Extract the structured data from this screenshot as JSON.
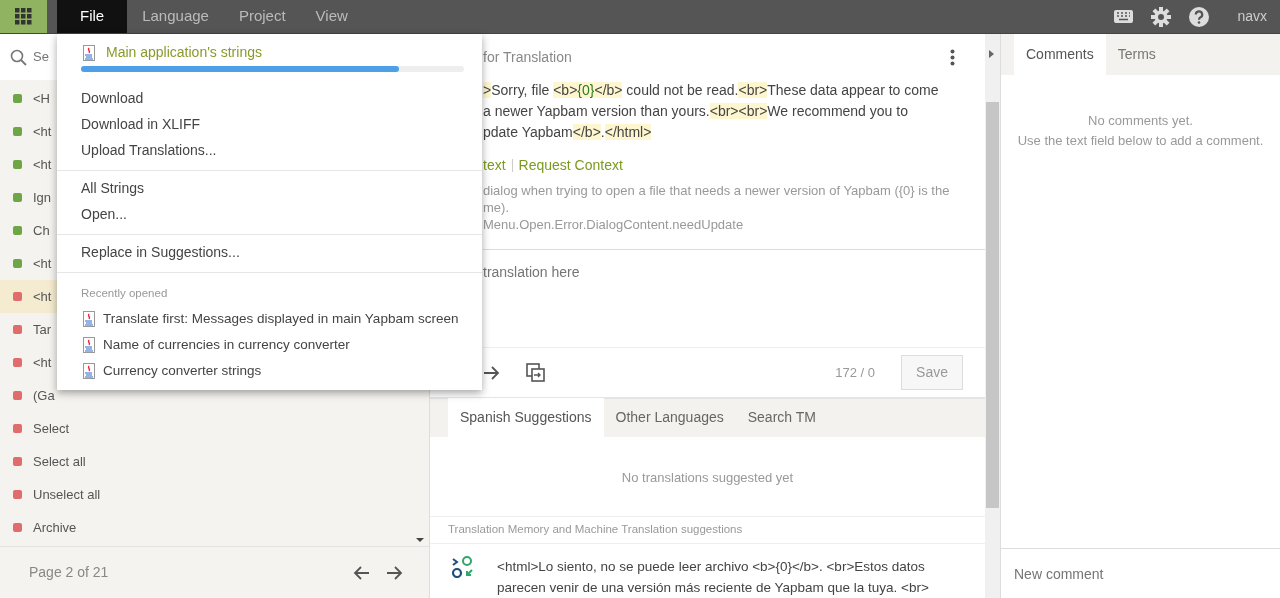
{
  "top_bar": {
    "menus": [
      {
        "label": "File",
        "selected": true
      },
      {
        "label": "Language",
        "selected": false
      },
      {
        "label": "Project",
        "selected": false
      },
      {
        "label": "View",
        "selected": false
      }
    ],
    "user": "navx"
  },
  "file_menu": {
    "file": {
      "name": "Main application's strings",
      "level": 0.83
    },
    "groups": [
      [
        "Download",
        "Download in XLIFF",
        "Upload Translations..."
      ],
      [
        "All Strings",
        "Open..."
      ],
      [
        "Replace in Suggestions..."
      ]
    ],
    "recent_label": "Recently opened",
    "recent": [
      "Translate first: Messages displayed in main Yapbam screen",
      "Name of currencies in currency converter",
      "Currency converter strings"
    ]
  },
  "strings_panel": {
    "search": {
      "placeholder": "Se"
    },
    "items": [
      {
        "text": "<H",
        "color": "#6ea646",
        "selected": false
      },
      {
        "text": "<ht",
        "color": "#6ea646",
        "selected": false
      },
      {
        "text": "<ht",
        "color": "#6ea646",
        "selected": false
      },
      {
        "text": "Ign",
        "color": "#6ea646",
        "selected": false
      },
      {
        "text": "Ch",
        "color": "#6ea646",
        "selected": false
      },
      {
        "text": "<ht",
        "color": "#6ea646",
        "selected": false
      },
      {
        "text": "<ht",
        "color": "#e06c6c",
        "selected": true
      },
      {
        "text": "Tar",
        "color": "#e06c6c",
        "selected": false
      },
      {
        "text": "<ht",
        "color": "#e06c6c",
        "selected": false
      },
      {
        "text": "(Ga",
        "color": "#e06c6c",
        "selected": false
      },
      {
        "text": "Select",
        "color": "#e06c6c",
        "selected": false
      },
      {
        "text": "Select all",
        "color": "#e06c6c",
        "selected": false
      },
      {
        "text": "Unselect all",
        "color": "#e06c6c",
        "selected": false
      },
      {
        "text": "Archive",
        "color": "#e06c6c",
        "selected": false
      }
    ],
    "page": "Page 2 of 21"
  },
  "editor": {
    "title": "for Translation",
    "source_lines": [
      [
        {
          "kind": "tag",
          "text": ">"
        },
        {
          "kind": "text",
          "text": "Sorry, file "
        },
        {
          "kind": "tag",
          "text": "<b>"
        },
        {
          "kind": "var",
          "text": "{0}"
        },
        {
          "kind": "tag",
          "text": "</b>"
        },
        {
          "kind": "text",
          "text": " could not be read."
        },
        {
          "kind": "tag",
          "text": "<br>"
        },
        {
          "kind": "text",
          "text": "These data appear to come"
        }
      ],
      [
        {
          "kind": "text",
          "text": "a newer Yapbam version than yours."
        },
        {
          "kind": "tag",
          "text": "<br><br>"
        },
        {
          "kind": "text",
          "text": "We recommend you to"
        }
      ],
      [
        {
          "kind": "text",
          "text": "pdate Yapbam"
        },
        {
          "kind": "tag",
          "text": "</b>"
        },
        {
          "kind": "text",
          "text": "."
        },
        {
          "kind": "tag",
          "text": "</html>"
        }
      ]
    ],
    "links": [
      "text",
      "Request Context"
    ],
    "description_lines": [
      "dialog when trying to open a file that needs a newer version of Yapbam ({0} is the",
      "me).",
      "Menu.Open.Error.DialogContent.needUpdate"
    ],
    "translation": {
      "placeholder": "translation here"
    },
    "counter": "172 / 0",
    "save": "Save"
  },
  "suggestions": {
    "tabs": [
      {
        "label": "Spanish Suggestions",
        "selected": true
      },
      {
        "label": "Other Languages",
        "selected": false
      },
      {
        "label": "Search TM",
        "selected": false
      }
    ],
    "empty": "No translations suggested yet",
    "tm_label": "Translation Memory and Machine Translation suggestions",
    "tm_lines": [
      "<html>Lo siento, no se puede leer archivo <b>{0}</b>. <br>Estos datos",
      "parecen venir de una versión más reciente de Yapbam que la tuya. <br>"
    ]
  },
  "comments_panel": {
    "tabs": [
      {
        "label": "Comments",
        "selected": true
      },
      {
        "label": "Terms",
        "selected": false
      }
    ],
    "empty_lines": [
      "No comments yet.",
      "Use the text field below to add a comment."
    ],
    "new_comment": {
      "placeholder": "New comment"
    }
  }
}
